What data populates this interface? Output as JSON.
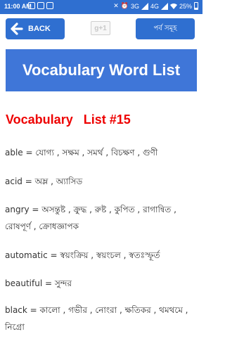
{
  "status_bar": {
    "time": "11:00 AM",
    "network": "3G",
    "network2": "4G",
    "battery": "25%",
    "icons": [
      "notification-icon",
      "sim-icon",
      "mute-icon",
      "alarm-icon",
      "wifi-icon",
      "signal-icon",
      "battery-icon"
    ]
  },
  "toolbar": {
    "back_label": "BACK",
    "gplus_label": "g+1",
    "chapters_label": "পর্ব সমূহ"
  },
  "banner": {
    "title": "Vocabulary Word List"
  },
  "list": {
    "heading": "Vocabulary   List #15",
    "entries": [
      "able = যোগ্য , সক্ষম , সমর্থ , বিচক্ষণ , গুণী",
      "acid = অম্ল , অ্যাসিড",
      "angry = অসন্তুষ্ট , ক্রুদ্ধ , রুষ্ট , কুপিত , রাগান্বিত , রোষপূর্ণ , ক্রোধজ্ঞাপক",
      "automatic = স্বয়ংক্রিয় , স্বয়ংচল , স্বতঃস্ফূর্ত",
      "beautiful = সুন্দর",
      "black = কালো , গভীর , নোংরা , ক্ষতিকর , থমথমে , নিগ্রো"
    ]
  },
  "colors": {
    "primary": "#2f6fd0",
    "banner": "#3f76d8",
    "heading": "#ee0000"
  }
}
